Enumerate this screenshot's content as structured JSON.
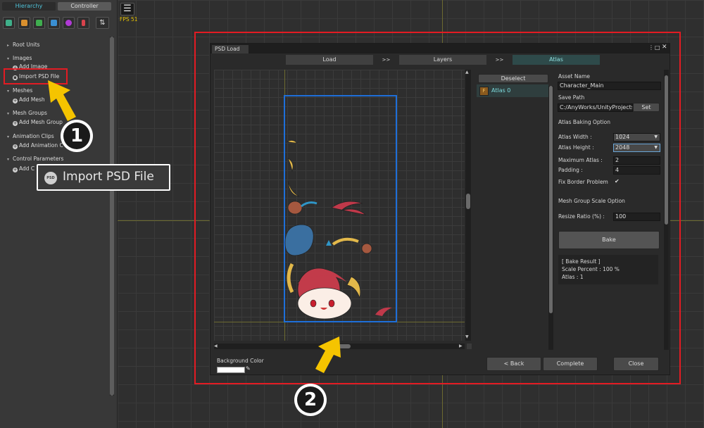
{
  "sidebar": {
    "tabs": {
      "hierarchy": "Hierarchy",
      "controller": "Controller"
    },
    "tree": {
      "root_units": "Root Units",
      "images": "Images",
      "add_image": "Add Image",
      "import_psd": "Import PSD File",
      "meshes": "Meshes",
      "add_mesh": "Add Mesh",
      "mesh_groups": "Mesh Groups",
      "add_mesh_group": "Add Mesh Group",
      "animation_clips": "Animation Clips",
      "add_animation_clip": "Add Animation C",
      "control_parameters": "Control Parameters",
      "add_control_param": "Add C"
    },
    "callout": {
      "psd_badge": "PSD",
      "label": "Import PSD File"
    }
  },
  "fps": "FPS 51",
  "markers": {
    "one": "1",
    "two": "2"
  },
  "dialog": {
    "title": "PSD Load",
    "steps": {
      "load": "Load",
      "sep1": ">>",
      "layers": "Layers",
      "sep2": ">>",
      "atlas": "Atlas"
    },
    "deselect": "Deselect",
    "atlas_item": "Atlas 0",
    "settings": {
      "asset_name_label": "Asset Name",
      "asset_name": "Character_Main",
      "save_path_label": "Save Path",
      "save_path": "C:/AnyWorks/UnityProjects",
      "set_button": "Set",
      "baking_option": "Atlas Baking Option",
      "atlas_width_label": "Atlas Width :",
      "atlas_width": "1024",
      "atlas_height_label": "Atlas Height :",
      "atlas_height": "2048",
      "max_atlas_label": "Maximum Atlas :",
      "max_atlas": "2",
      "padding_label": "Padding :",
      "padding": "4",
      "fix_border_label": "Fix Border Problem",
      "fix_border_check": "✔",
      "scale_option": "Mesh Group Scale Option",
      "resize_label": "Resize Ratio (%) :",
      "resize": "100",
      "bake_button": "Bake",
      "result_title": "[ Bake Result ]",
      "result_scale": "Scale Percent : 100 %",
      "result_atlas": "Atlas : 1"
    },
    "bg_color_label": "Background Color",
    "footer": {
      "back": "< Back",
      "complete": "Complete",
      "close": "Close"
    }
  },
  "colors": {
    "highlight_red": "#e31b23",
    "atlas_blue": "#1e6fd9",
    "arrow_yellow": "#f5c400"
  }
}
